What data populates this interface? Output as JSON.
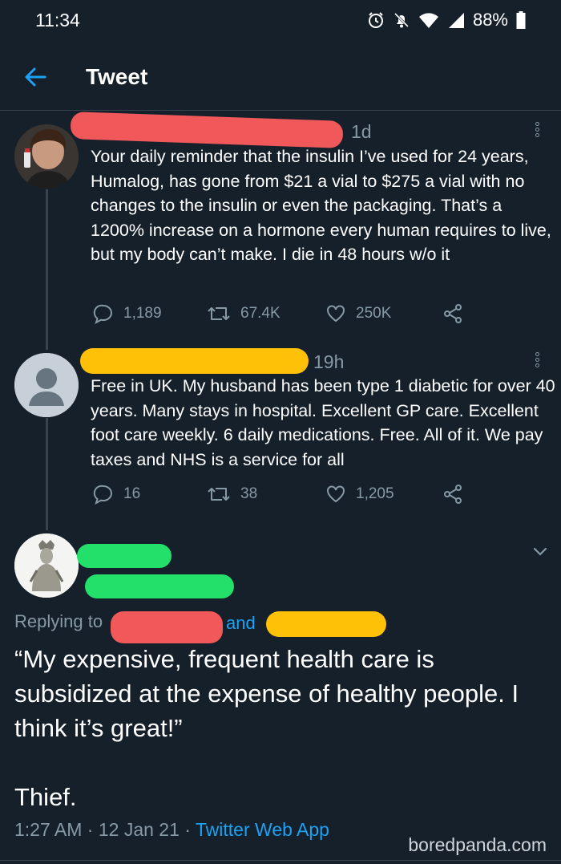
{
  "status_bar": {
    "time": "11:34",
    "battery": "88%",
    "icons": [
      "alarm-icon",
      "bell-off-icon",
      "wifi-icon",
      "signal-icon",
      "battery-icon"
    ]
  },
  "header": {
    "back_icon": "arrow-left-icon",
    "title": "Tweet"
  },
  "colors": {
    "background": "#15202b",
    "accent": "#1da1f2",
    "muted": "#8899a6",
    "redact_red": "#f0585a",
    "redact_yellow": "#ffc107",
    "redact_green": "#22e06a"
  },
  "tweet1": {
    "time": "1d",
    "text": "Your daily reminder that the insulin I’ve used for 24 years, Humalog, has gone from $21 a vial to $275 a vial with no changes to the insulin or even the packaging. That’s a 1200% increase on a hormone every human requires to live, but my body can’t make. I die in 48 hours w/o it",
    "replies": "1,189",
    "retweets": "67.4K",
    "likes": "250K"
  },
  "tweet2": {
    "time": "19h",
    "text": "Free in UK. My husband has been type 1 diabetic for over 40 years. Many stays in hospital. Excellent GP care. Excellent foot care weekly. 6 daily medications. Free. All of it. We pay taxes and NHS is a service for all",
    "replies": "16",
    "retweets": "38",
    "likes": "1,205"
  },
  "main_tweet": {
    "replying_prefix": "Replying to",
    "replying_and": "and",
    "text": "“My expensive, frequent health care is subsidized at the expense of healthy people. I think it’s great!”\n\nThief.",
    "time": "1:27 AM",
    "date": "12 Jan 21",
    "app": "Twitter Web App"
  },
  "watermark": "boredpanda.com"
}
